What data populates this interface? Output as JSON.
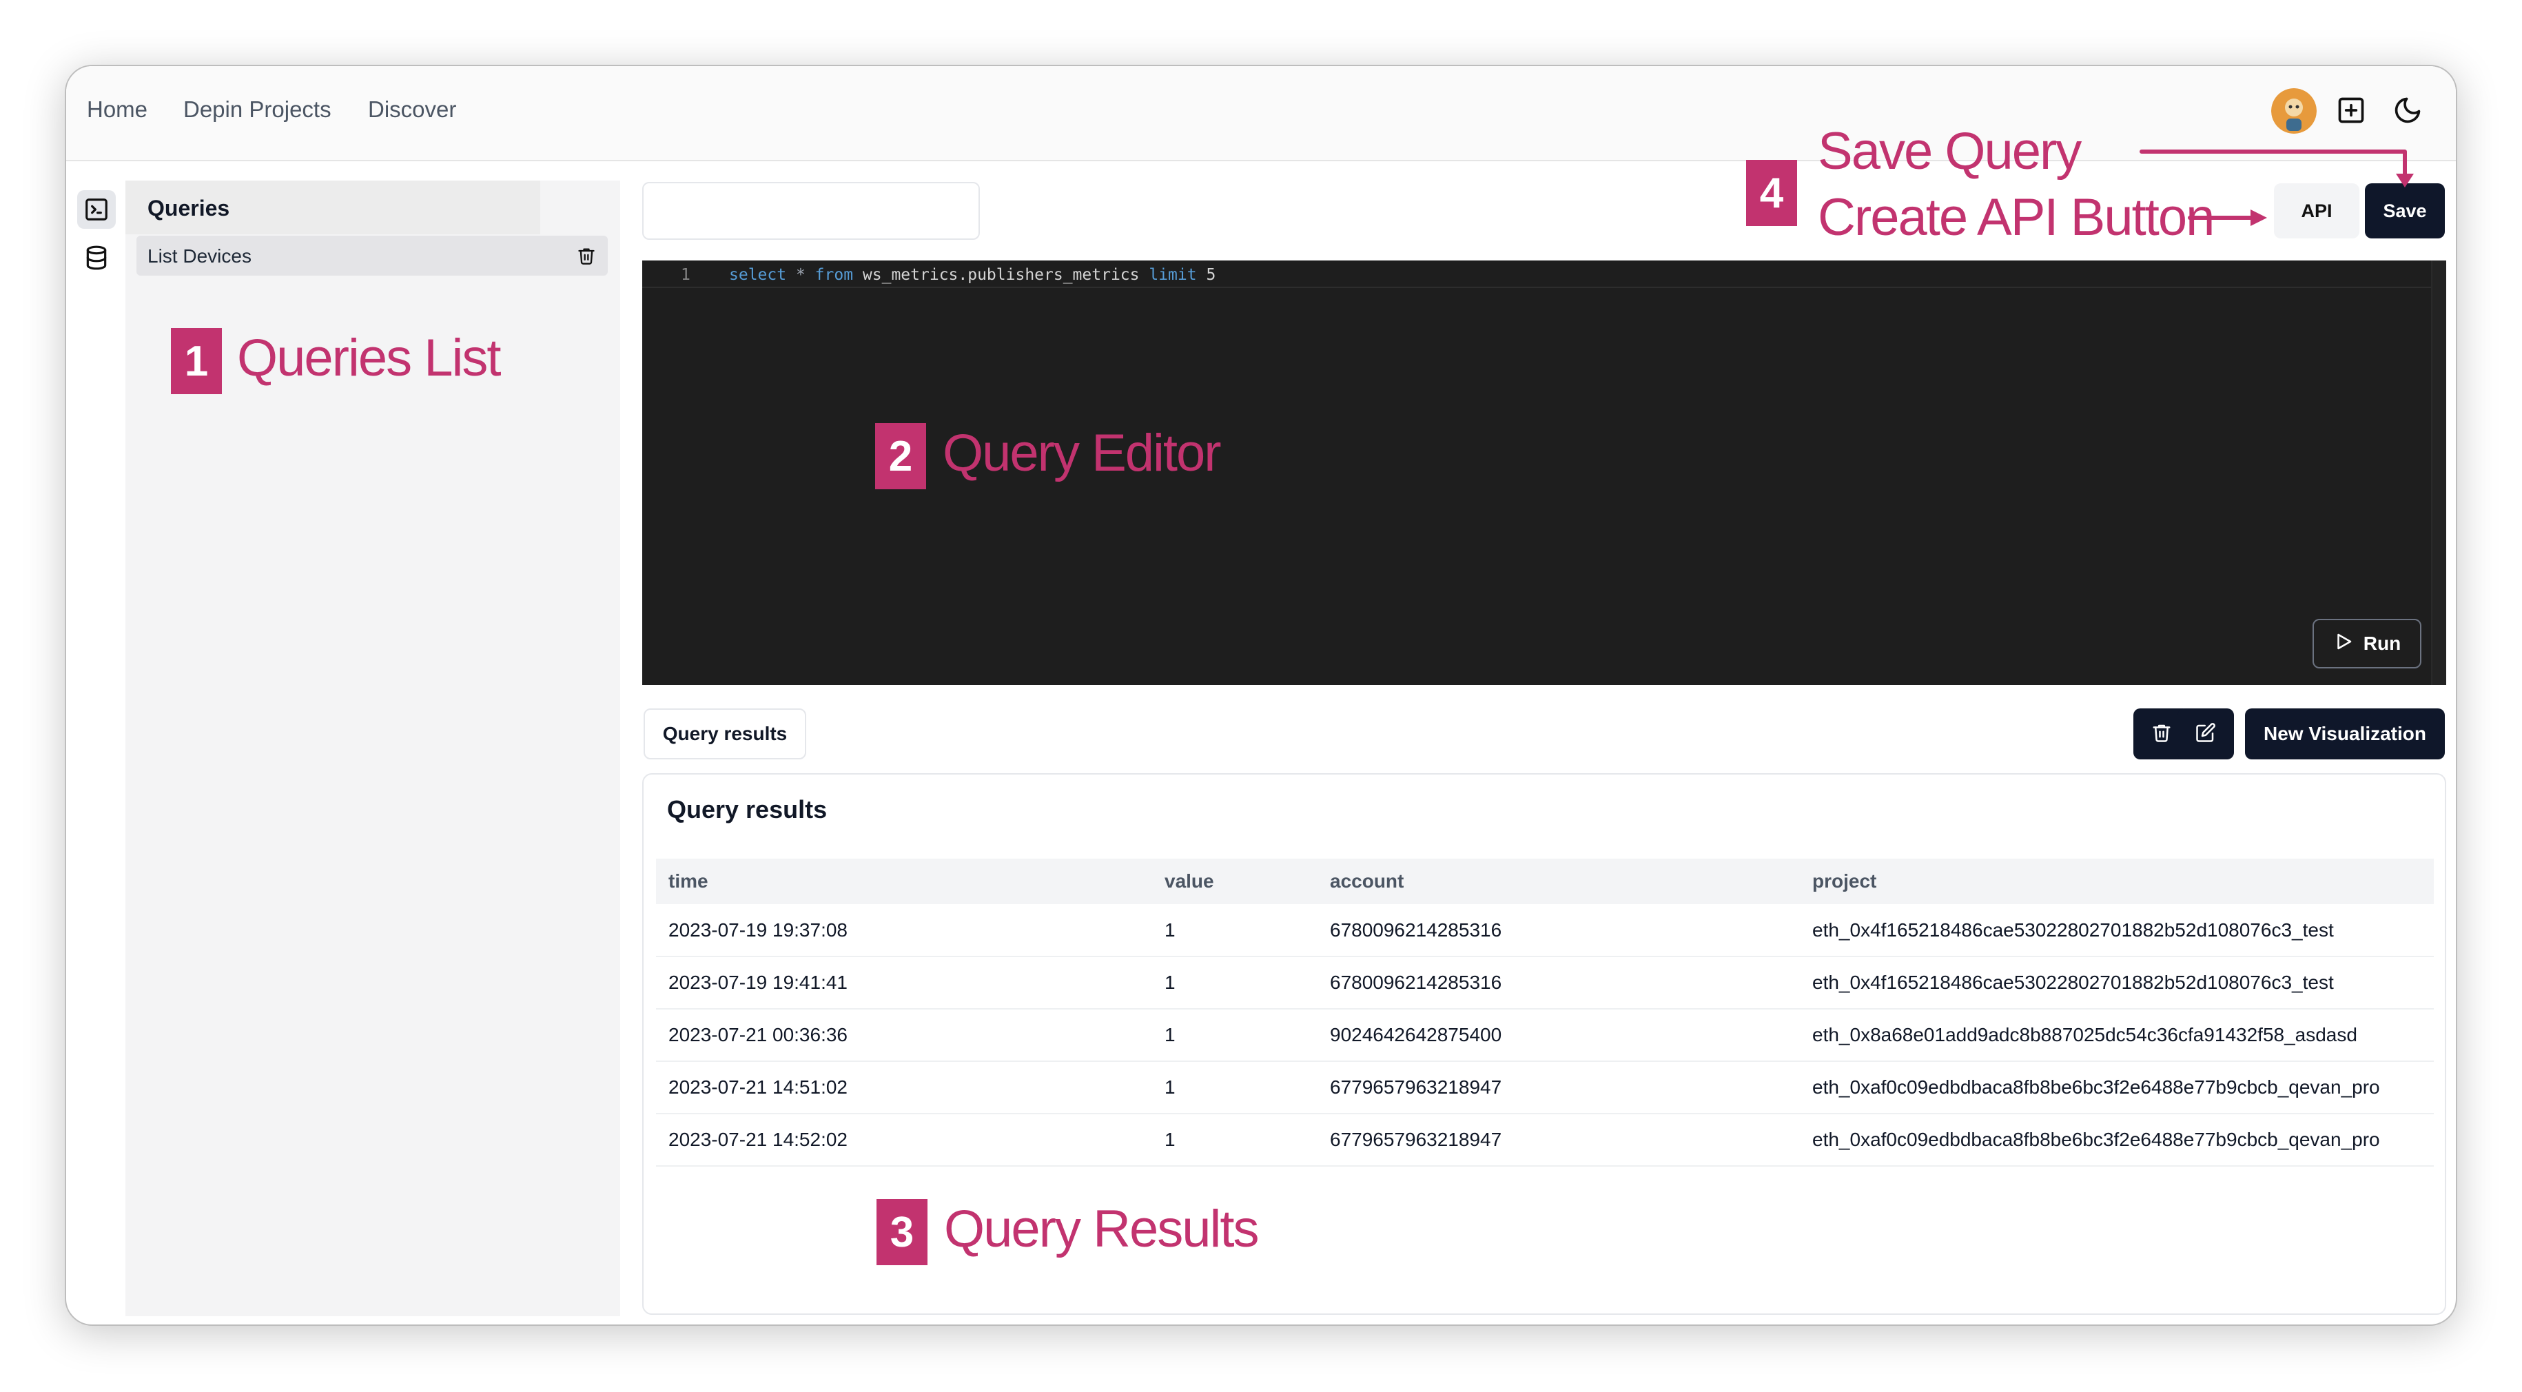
{
  "nav": {
    "home": "Home",
    "depin_projects": "Depin Projects",
    "discover": "Discover"
  },
  "sidebar": {
    "queries_title": "Queries",
    "items": [
      {
        "label": "List Devices"
      }
    ]
  },
  "toolbar": {
    "query_name_value": "",
    "api_label": "API",
    "save_label": "Save"
  },
  "editor": {
    "line_number": "1",
    "code_tokens": [
      "select",
      "*",
      "from",
      "ws_metrics.publishers_metrics",
      "limit",
      "5"
    ],
    "run_label": "Run"
  },
  "results": {
    "tab_label": "Query results",
    "new_visualization_label": "New Visualization",
    "card_title": "Query results",
    "columns": [
      "time",
      "value",
      "account",
      "project"
    ],
    "rows": [
      [
        "2023-07-19 19:37:08",
        "1",
        "6780096214285316",
        "eth_0x4f165218486cae53022802701882b52d108076c3_test"
      ],
      [
        "2023-07-19 19:41:41",
        "1",
        "6780096214285316",
        "eth_0x4f165218486cae53022802701882b52d108076c3_test"
      ],
      [
        "2023-07-21 00:36:36",
        "1",
        "9024642642875400",
        "eth_0x8a68e01add9adc8b887025dc54c36cfa91432f58_asdasd"
      ],
      [
        "2023-07-21 14:51:02",
        "1",
        "6779657963218947",
        "eth_0xaf0c09edbdbaca8fb8be6bc3f2e6488e77b9cbcb_qevan_pro"
      ],
      [
        "2023-07-21 14:52:02",
        "1",
        "6779657963218947",
        "eth_0xaf0c09edbdbaca8fb8be6bc3f2e6488e77b9cbcb_qevan_pro"
      ]
    ]
  },
  "annotations": {
    "queries_list": {
      "number": "1",
      "text": "Queries List"
    },
    "query_editor": {
      "number": "2",
      "text": "Query Editor"
    },
    "query_results": {
      "number": "3",
      "text": "Query Results"
    },
    "actions": {
      "number": "4",
      "save_query": "Save Query",
      "create_api": "Create API Button"
    }
  },
  "colors": {
    "annotation": "#c2336f",
    "editor_bg": "#1e1e1e",
    "primary_button": "#0f172a",
    "sql_keyword": "#569cd6"
  },
  "icons": {
    "rail": [
      "terminal-icon",
      "database-icon"
    ],
    "header": [
      "avatar",
      "plus-square-icon",
      "moon-icon"
    ],
    "actions": [
      "trash-icon",
      "edit-icon",
      "play-icon"
    ]
  }
}
